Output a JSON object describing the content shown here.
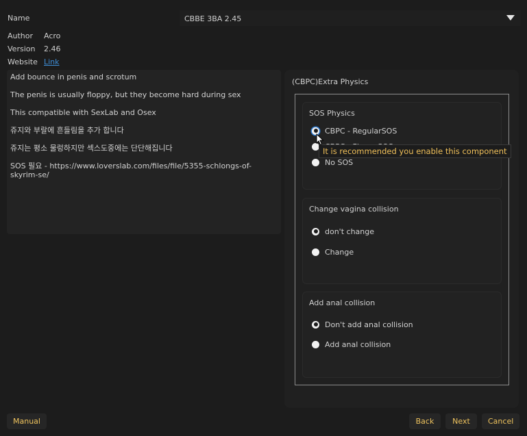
{
  "header": {
    "name_label": "Name",
    "name_value": "CBBE 3BA 2.45",
    "author_label": "Author",
    "author_value": "Acro",
    "version_label": "Version",
    "version_value": "2.46",
    "website_label": "Website",
    "website_link": "Link"
  },
  "description": {
    "lines": [
      "Add bounce in penis and scrotum",
      "The penis is usually floppy, but they become hard during sex",
      "This compatible with SexLab and Osex",
      "쥬지와 부랄에 흔들림을 추가 합니다",
      "쥬지는 평소 물렁하지만 섹스도중에는 단단해집니다",
      "SOS 필요 - https://www.loverslab.com/files/file/5355-schlongs-of-skyrim-se/"
    ]
  },
  "page": {
    "title": "(CBPC)Extra Physics",
    "groups": [
      {
        "title": "SOS Physics",
        "options": [
          {
            "label": "CBPC - RegularSOS",
            "checked": true
          },
          {
            "label": "CBPC - FloppySOS",
            "checked": false
          },
          {
            "label": "No SOS",
            "checked": false
          }
        ]
      },
      {
        "title": "Change vagina collision",
        "options": [
          {
            "label": "don't change",
            "checked": true
          },
          {
            "label": "Change",
            "checked": false
          }
        ]
      },
      {
        "title": "Add anal collision",
        "options": [
          {
            "label": "Don't add anal collision",
            "checked": true
          },
          {
            "label": "Add anal collision",
            "checked": false
          }
        ]
      }
    ]
  },
  "tooltip": "It is recommended you enable this component",
  "buttons": {
    "manual": "Manual",
    "back": "Back",
    "next": "Next",
    "cancel": "Cancel"
  },
  "icons": {
    "dropdown": "chevron-down-icon",
    "cursor": "mouse-pointer-icon"
  },
  "colors": {
    "accent_text": "#f0c45e",
    "link": "#3f8fd8",
    "focus": "#2e7bd1"
  }
}
